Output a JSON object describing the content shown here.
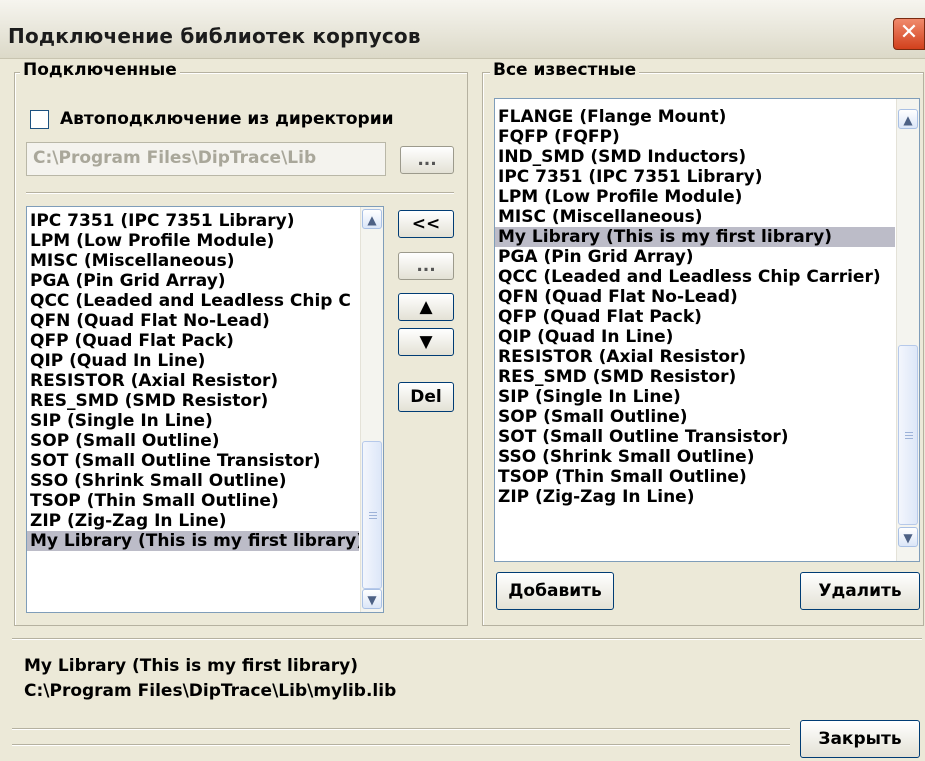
{
  "window": {
    "title": "Подключение библиотек корпусов",
    "close_glyph": "✕"
  },
  "connected": {
    "legend": "Подключенные",
    "autoconnect_label": "Автоподключение из директории",
    "autoconnect_checked": false,
    "directory_value": "C:\\Program Files\\DipTrace\\Lib",
    "browse_label": "...",
    "items": [
      "IPC 7351 (IPC 7351 Library)",
      "LPM (Low Profile Module)",
      "MISC (Miscellaneous)",
      "PGA (Pin Grid Array)",
      "QCC (Leaded and Leadless Chip C",
      "QFN (Quad Flat No-Lead)",
      "QFP (Quad Flat Pack)",
      "QIP (Quad In Line)",
      "RESISTOR (Axial Resistor)",
      "RES_SMD (SMD Resistor)",
      "SIP (Single In Line)",
      "SOP (Small Outline)",
      "SOT (Small Outline Transistor)",
      "SSO (Shrink Small Outline)",
      "TSOP (Thin Small Outline)",
      "ZIP (Zig-Zag In Line)",
      "My Library (This is my first library)"
    ],
    "selected_index": 16
  },
  "side_buttons": {
    "add_label": "<<",
    "edit_label": "...",
    "up_icon": "▲",
    "down_icon": "▼",
    "delete_label": "Del"
  },
  "known": {
    "legend": "Все известные",
    "items": [
      "FLANGE (Flange Mount)",
      "FQFP (FQFP)",
      "IND_SMD (SMD Inductors)",
      "IPC 7351 (IPC 7351 Library)",
      "LPM (Low Profile Module)",
      "MISC (Miscellaneous)",
      "My Library (This is my first library)",
      "PGA (Pin Grid Array)",
      "QCC (Leaded and Leadless Chip Carrier)",
      "QFN (Quad Flat No-Lead)",
      "QFP (Quad Flat Pack)",
      "QIP (Quad In Line)",
      "RESISTOR (Axial Resistor)",
      "RES_SMD (SMD Resistor)",
      "SIP (Single In Line)",
      "SOP (Small Outline)",
      "SOT (Small Outline Transistor)",
      "SSO (Shrink Small Outline)",
      "TSOP (Thin Small Outline)",
      "ZIP (Zig-Zag In Line)"
    ],
    "selected_index": 6,
    "add_label": "Добавить",
    "remove_label": "Удалить"
  },
  "info": {
    "library_name": "My Library (This is my first library)",
    "library_path": "C:\\Program Files\\DipTrace\\Lib\\mylib.lib"
  },
  "footer": {
    "close_label": "Закрыть"
  },
  "scroll_arrows": {
    "up": "▲",
    "down": "▼"
  }
}
